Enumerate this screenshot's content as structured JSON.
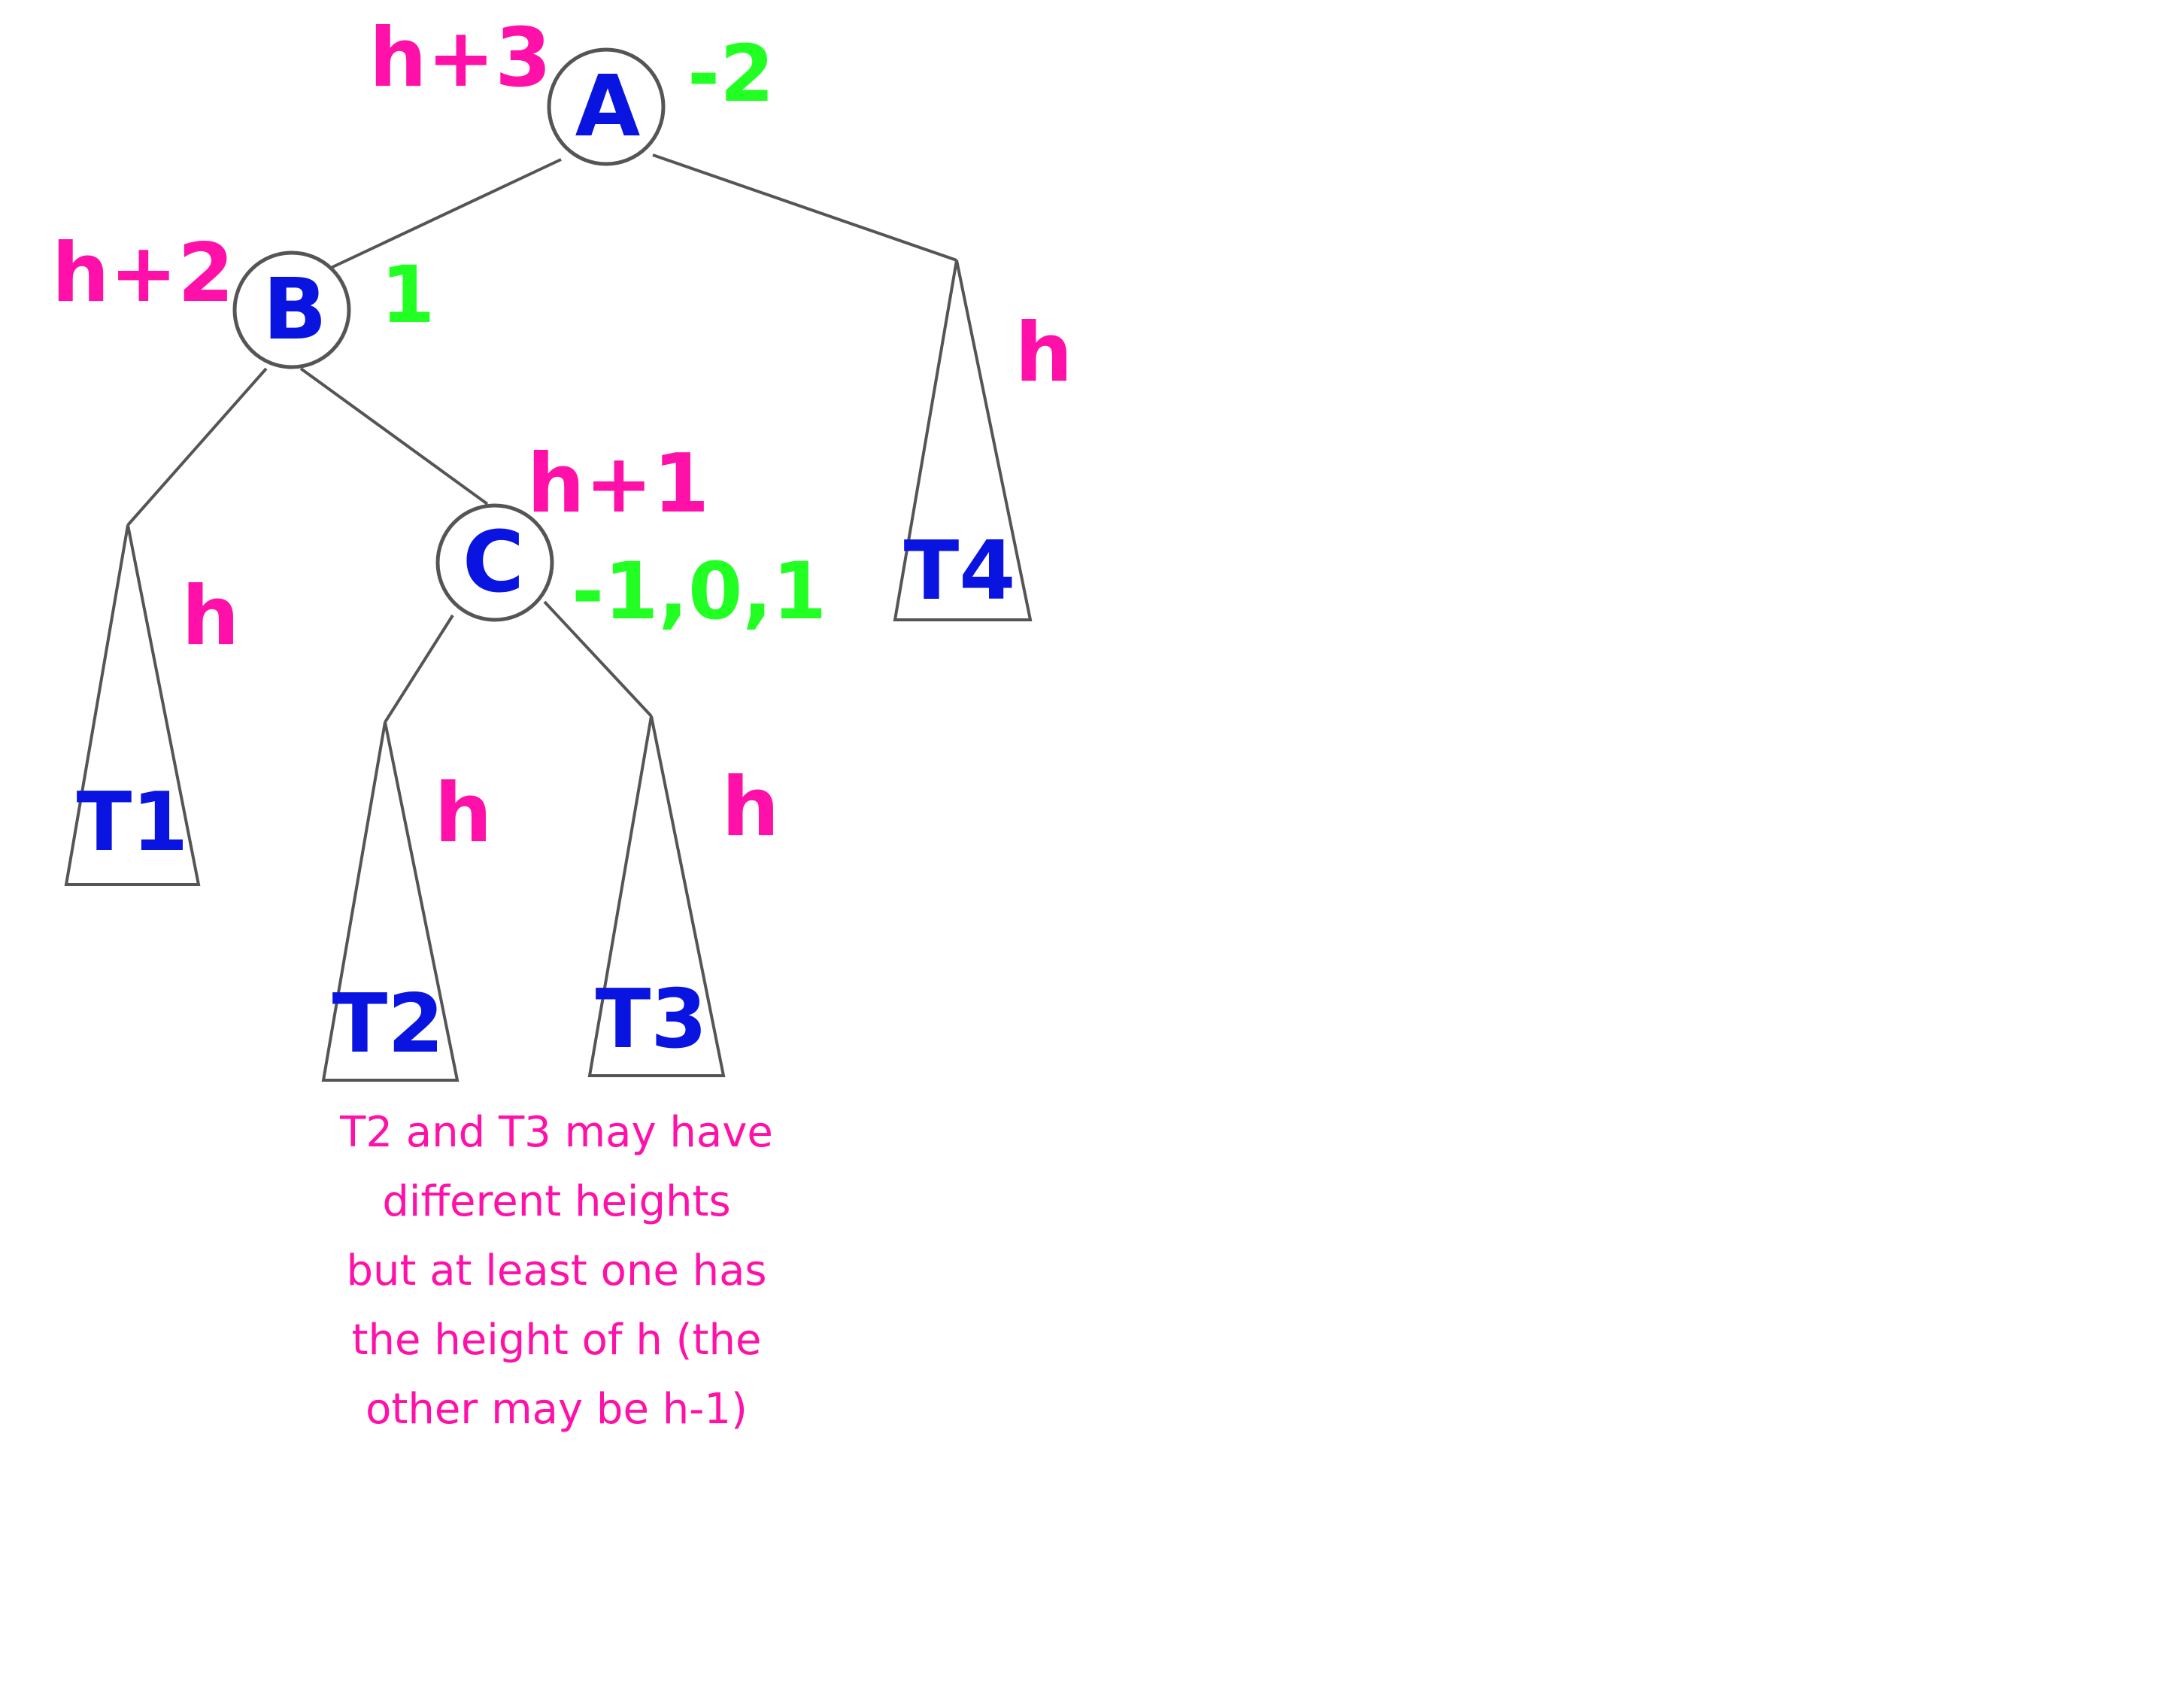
{
  "colors": {
    "node_text": "#0a14e0",
    "height_text": "#ff10a8",
    "balance_text": "#22ff22",
    "line": "#555555"
  },
  "nodes": {
    "A": {
      "label": "A",
      "height": "h+3",
      "balance": "-2"
    },
    "B": {
      "label": "B",
      "height": "h+2",
      "balance": "1"
    },
    "C": {
      "label": "C",
      "height": "h+1",
      "balance": "-1,0,1"
    }
  },
  "subtrees": {
    "T1": {
      "label": "T1",
      "height": "h"
    },
    "T2": {
      "label": "T2",
      "height": "h"
    },
    "T3": {
      "label": "T3",
      "height": "h"
    },
    "T4": {
      "label": "T4",
      "height": "h"
    }
  },
  "note": "T2 and T3 may have\ndifferent heights\nbut at least one has\nthe height of h (the\nother may be h-1)"
}
